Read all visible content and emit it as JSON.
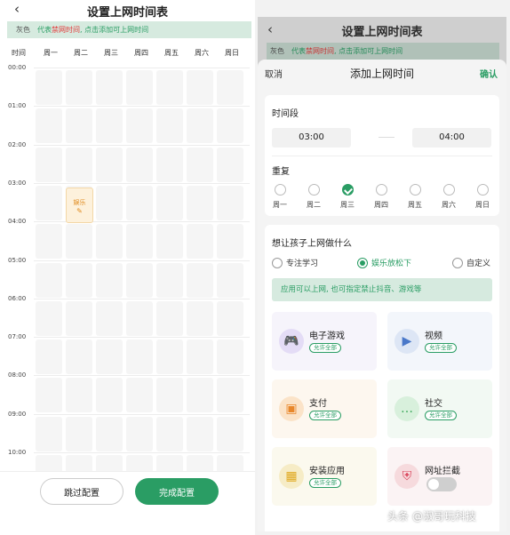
{
  "left": {
    "back_icon": "chevron-left-icon",
    "title": "设置上网时间表",
    "legend": {
      "key": "灰色",
      "text_a": "代表",
      "text_b": "禁网时间",
      "text_c": ", 点击添加可上网时间"
    },
    "time_header": "时间",
    "days": [
      "周一",
      "周二",
      "周三",
      "周四",
      "周五",
      "周六",
      "周日"
    ],
    "hours": [
      "00:00",
      "01:00",
      "02:00",
      "03:00",
      "04:00",
      "05:00",
      "06:00",
      "07:00",
      "08:00",
      "09:00",
      "10:00"
    ],
    "entertainment_block": {
      "label": "娱乐",
      "icon": "edit-icon"
    },
    "skip_button": "跳过配置",
    "done_button": "完成配置"
  },
  "right": {
    "back_icon": "chevron-left-icon",
    "title": "设置上网时间表",
    "legend": {
      "key": "灰色",
      "text_a": "代表",
      "text_b": "禁网时间",
      "text_c": ", 点击添加可上网时间"
    },
    "sheet": {
      "cancel": "取消",
      "title": "添加上网时间",
      "confirm": "确认",
      "period_label": "时间段",
      "start_time": "03:00",
      "end_time": "04:00",
      "repeat_label": "重复",
      "weekdays": [
        {
          "label": "周一",
          "checked": false
        },
        {
          "label": "周二",
          "checked": false
        },
        {
          "label": "周三",
          "checked": true
        },
        {
          "label": "周四",
          "checked": false
        },
        {
          "label": "周五",
          "checked": false
        },
        {
          "label": "周六",
          "checked": false
        },
        {
          "label": "周日",
          "checked": false
        }
      ],
      "purpose_label": "想让孩子上网做什么",
      "purposes": [
        {
          "label": "专注学习",
          "selected": false
        },
        {
          "label": "娱乐放松下",
          "selected": true
        },
        {
          "label": "自定义",
          "selected": false
        }
      ],
      "tip": "应用可以上网, 也可指定禁止抖音、游戏等",
      "apps": [
        {
          "name": "电子游戏",
          "badge": "允许全部",
          "icon": "gamepad-icon"
        },
        {
          "name": "视频",
          "badge": "允许全部",
          "icon": "video-icon"
        },
        {
          "name": "支付",
          "badge": "允许全部",
          "icon": "wallet-icon"
        },
        {
          "name": "社交",
          "badge": "允许全部",
          "icon": "chat-icon"
        },
        {
          "name": "安装应用",
          "badge": "允许全部",
          "icon": "app-grid-icon"
        },
        {
          "name": "网址拦截",
          "icon": "shield-icon",
          "toggle_on": false
        }
      ]
    }
  },
  "watermark": "头条 @淑哥玩科技",
  "colors": {
    "accent": "#2a9d64",
    "warning": "#e23b3b",
    "entertainment": "#e08a1e"
  }
}
